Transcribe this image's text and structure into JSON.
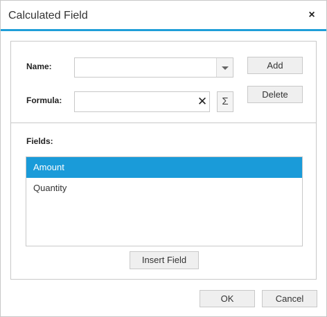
{
  "dialog": {
    "title": "Calculated Field",
    "close_glyph": "×"
  },
  "form": {
    "name_label": "Name:",
    "name_value": "",
    "formula_label": "Formula:",
    "formula_value": "",
    "clear_glyph": "✕",
    "sigma_glyph": "Σ",
    "add_label": "Add",
    "delete_label": "Delete"
  },
  "fields": {
    "label": "Fields:",
    "items": [
      {
        "label": "Amount",
        "selected": true
      },
      {
        "label": "Quantity",
        "selected": false
      }
    ],
    "insert_label": "Insert Field"
  },
  "footer": {
    "ok_label": "OK",
    "cancel_label": "Cancel"
  },
  "colors": {
    "accent": "#1f9ed8",
    "selected_row": "#1a9bd9"
  },
  "icons": {
    "close": "close-icon",
    "dropdown": "chevron-down-icon",
    "clear": "clear-icon",
    "sigma": "sigma-icon"
  }
}
